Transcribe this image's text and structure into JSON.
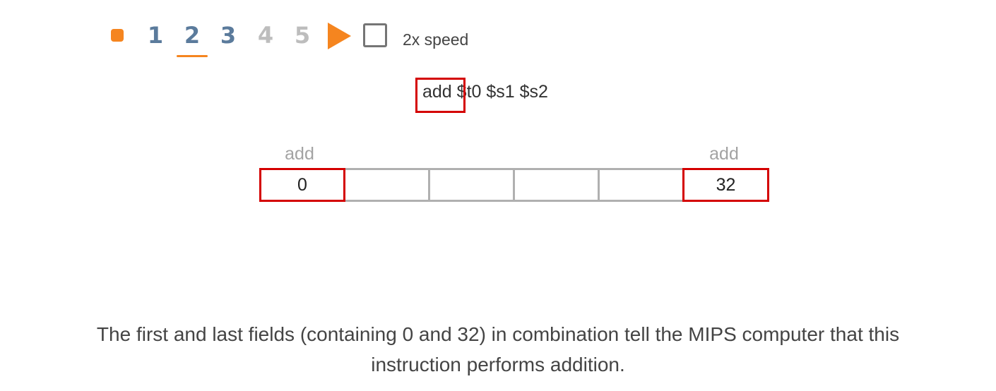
{
  "controls": {
    "steps": [
      {
        "label": "1",
        "state": "done"
      },
      {
        "label": "2",
        "state": "current"
      },
      {
        "label": "3",
        "state": "done"
      },
      {
        "label": "4",
        "state": "pending"
      },
      {
        "label": "5",
        "state": "pending"
      }
    ],
    "speed_label": "2x speed",
    "speed_checked": false,
    "accent_color": "#f5851f"
  },
  "instruction": {
    "opcode": "add",
    "operands": " $t0 $s1 $s2"
  },
  "fields": {
    "labels": {
      "first": "add",
      "last": "add"
    },
    "values": [
      "0",
      "",
      "",
      "",
      "",
      "32"
    ],
    "highlight_color": "#d40000"
  },
  "caption": "The first and last fields (containing 0 and 32) in combination tell the MIPS computer that this instruction performs addition."
}
